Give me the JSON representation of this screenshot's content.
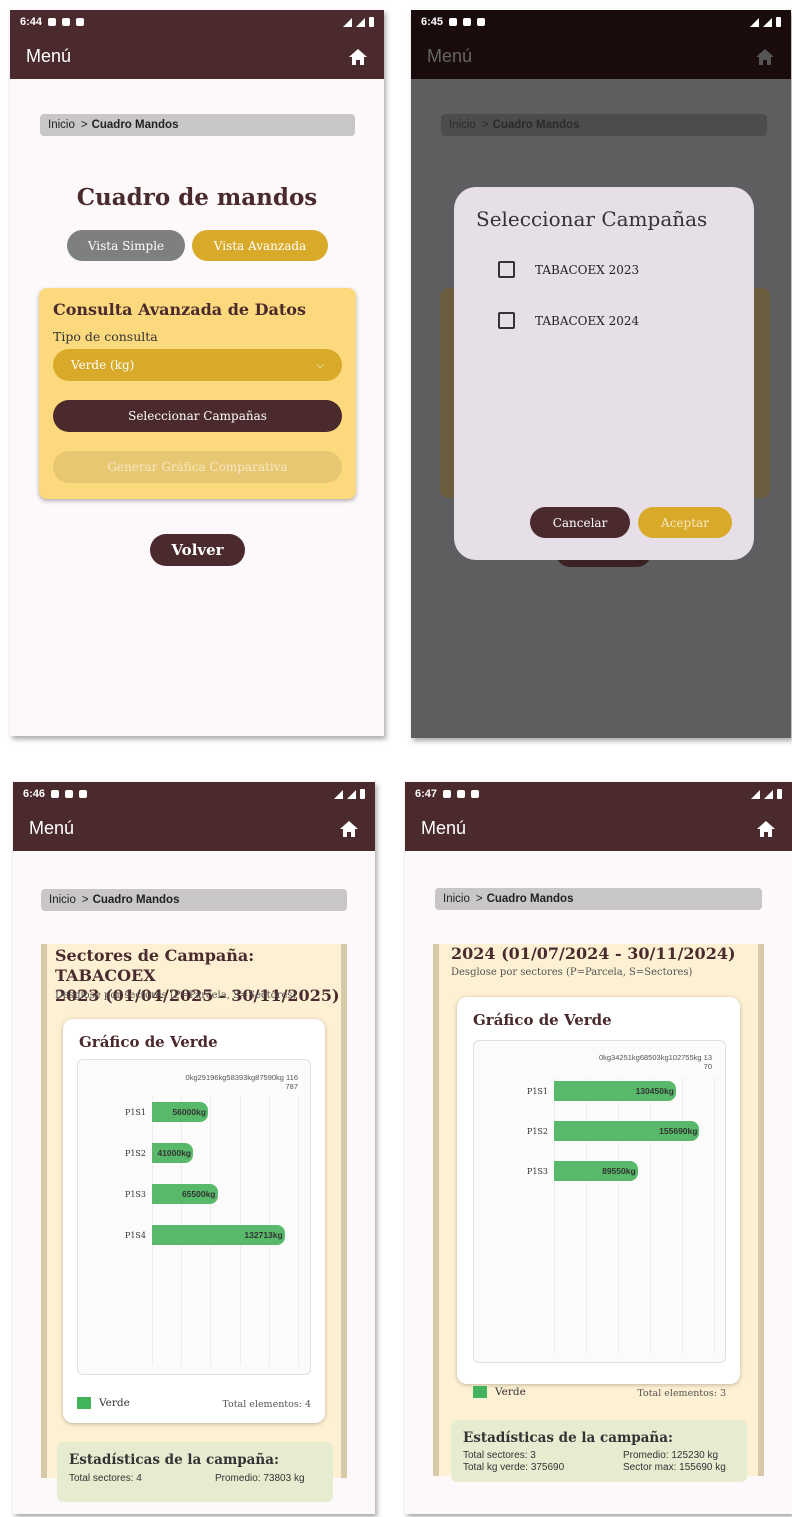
{
  "status": {
    "times": [
      "6:44",
      "6:45",
      "6:46",
      "6:47"
    ]
  },
  "appbar": {
    "title": "Menú"
  },
  "breadcrumb": {
    "home": "Inicio",
    "separator": ">",
    "current": "Cuadro Mandos"
  },
  "dashboard": {
    "title": "Cuadro de mandos",
    "view_simple": "Vista Simple",
    "view_advanced": "Vista Avanzada",
    "card_title": "Consulta Avanzada de Datos",
    "query_type_label": "Tipo de consulta",
    "query_type_value": "Verde (kg)",
    "select_campaigns_button": "Seleccionar Campañas",
    "generate_chart_button": "Generar Gráfica Comparativa",
    "back_button": "Volver"
  },
  "dialog": {
    "title": "Seleccionar Campañas",
    "options": [
      "TABACOEX 2023",
      "TABACOEX 2024"
    ],
    "cancel": "Cancelar",
    "accept": "Aceptar"
  },
  "campaign2023": {
    "title_line1": "Sectores de Campaña: TABACOEX",
    "title_line2": "2023 (01/04/2025 - 30/11/2025)",
    "subtitle": "Desglose por sectores (P=Parcela, S=Sectores)",
    "chart_title": "Gráfico de Verde",
    "tick_text_line1": "0kg29196kg58393kg87590kg 116",
    "tick_text_line2": "787",
    "legend": "Verde",
    "total_elements": "Total elementos: 4",
    "stats_title": "Estadísticas de la campaña:",
    "stats_total_sectors": "Total sectores: 4",
    "stats_average": "Promedio: 73803 kg"
  },
  "campaign2024": {
    "title_line1": "2024 (01/07/2024 - 30/11/2024)",
    "subtitle": "Desglose por sectores (P=Parcela, S=Sectores)",
    "chart_title": "Gráfico de Verde",
    "tick_text_line1": "0kg34251kg68503kg102755kg 13",
    "tick_text_line2": "70",
    "legend": "Verde",
    "total_elements": "Total elementos: 3",
    "stats_title": "Estadísticas de la campaña:",
    "stats_total_sectors": "Total sectores: 3",
    "stats_average": "Promedio: 125230 kg",
    "stats_total_kg": "Total kg verde: 375690",
    "stats_sector_max": "Sector max: 155690 kg"
  },
  "chart_data": [
    {
      "type": "bar",
      "orientation": "horizontal",
      "title": "Gráfico de Verde",
      "categories": [
        "P1S1",
        "P1S2",
        "P1S3",
        "P1S4"
      ],
      "series": [
        {
          "name": "Verde",
          "values": [
            56000,
            41000,
            65500,
            132713
          ]
        }
      ],
      "value_labels": [
        "56000kg",
        "41000kg",
        "65500kg",
        "132713kg"
      ],
      "xlim": [
        0,
        146000
      ],
      "color": "#58b96a"
    },
    {
      "type": "bar",
      "orientation": "horizontal",
      "title": "Gráfico de Verde",
      "categories": [
        "P1S1",
        "P1S2",
        "P1S3"
      ],
      "series": [
        {
          "name": "Verde",
          "values": [
            130450,
            155690,
            89550
          ]
        }
      ],
      "value_labels": [
        "130450kg",
        "155690kg",
        "89550kg"
      ],
      "xlim": [
        0,
        171250
      ],
      "color": "#58b96a"
    }
  ]
}
